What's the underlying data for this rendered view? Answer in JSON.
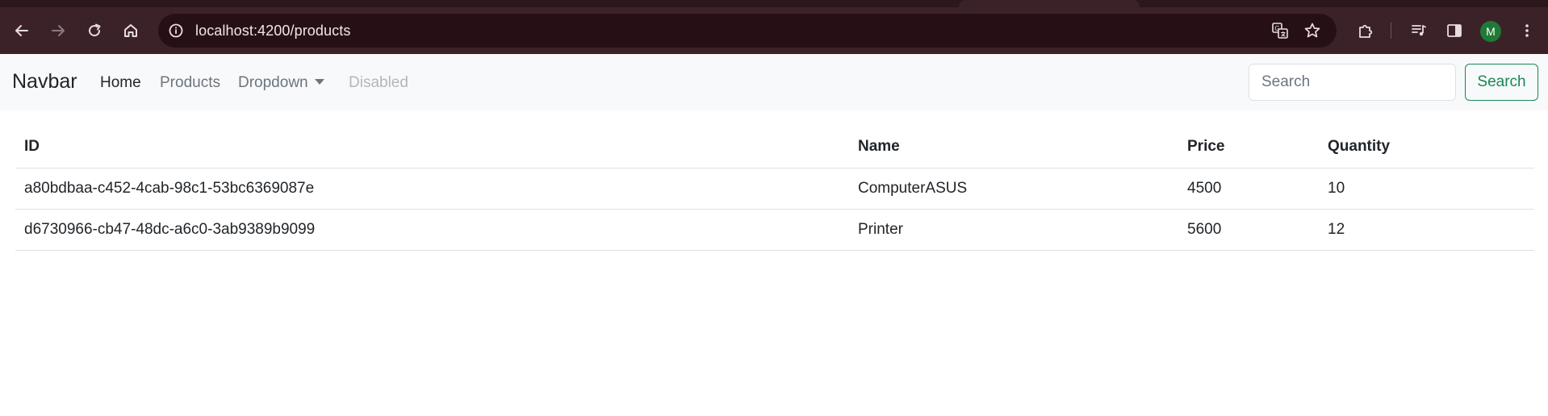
{
  "browser": {
    "url": "localhost:4200/products",
    "icons": {
      "back": "arrow-left-icon",
      "forward": "arrow-right-icon",
      "reload": "reload-icon",
      "home": "home-icon",
      "site_info": "info-circle-icon",
      "translate": "translate-icon",
      "bookmark": "star-icon",
      "extensions": "puzzle-icon",
      "media": "media-queue-icon",
      "side_panel": "side-panel-icon",
      "menu": "three-dots-icon"
    },
    "profile_initial": "M",
    "colors": {
      "frame": "#3b2228",
      "omnibox": "#261015",
      "avatar": "#1f7a36"
    }
  },
  "navbar": {
    "brand": "Navbar",
    "links": [
      {
        "label": "Home",
        "state": "active"
      },
      {
        "label": "Products",
        "state": "normal"
      },
      {
        "label": "Dropdown",
        "state": "dropdown"
      },
      {
        "label": "Disabled",
        "state": "disabled"
      }
    ],
    "search": {
      "placeholder": "Search",
      "value": "",
      "button_label": "Search"
    },
    "colors": {
      "background": "#f8f9fa",
      "success": "#198754"
    }
  },
  "products_table": {
    "columns": [
      "ID",
      "Name",
      "Price",
      "Quantity"
    ],
    "rows": [
      {
        "id": "a80bdbaa-c452-4cab-98c1-53bc6369087e",
        "name": "ComputerASUS",
        "price": "4500",
        "quantity": "10"
      },
      {
        "id": "d6730966-cb47-48dc-a6c0-3ab9389b9099",
        "name": "Printer",
        "price": "5600",
        "quantity": "12"
      }
    ]
  }
}
